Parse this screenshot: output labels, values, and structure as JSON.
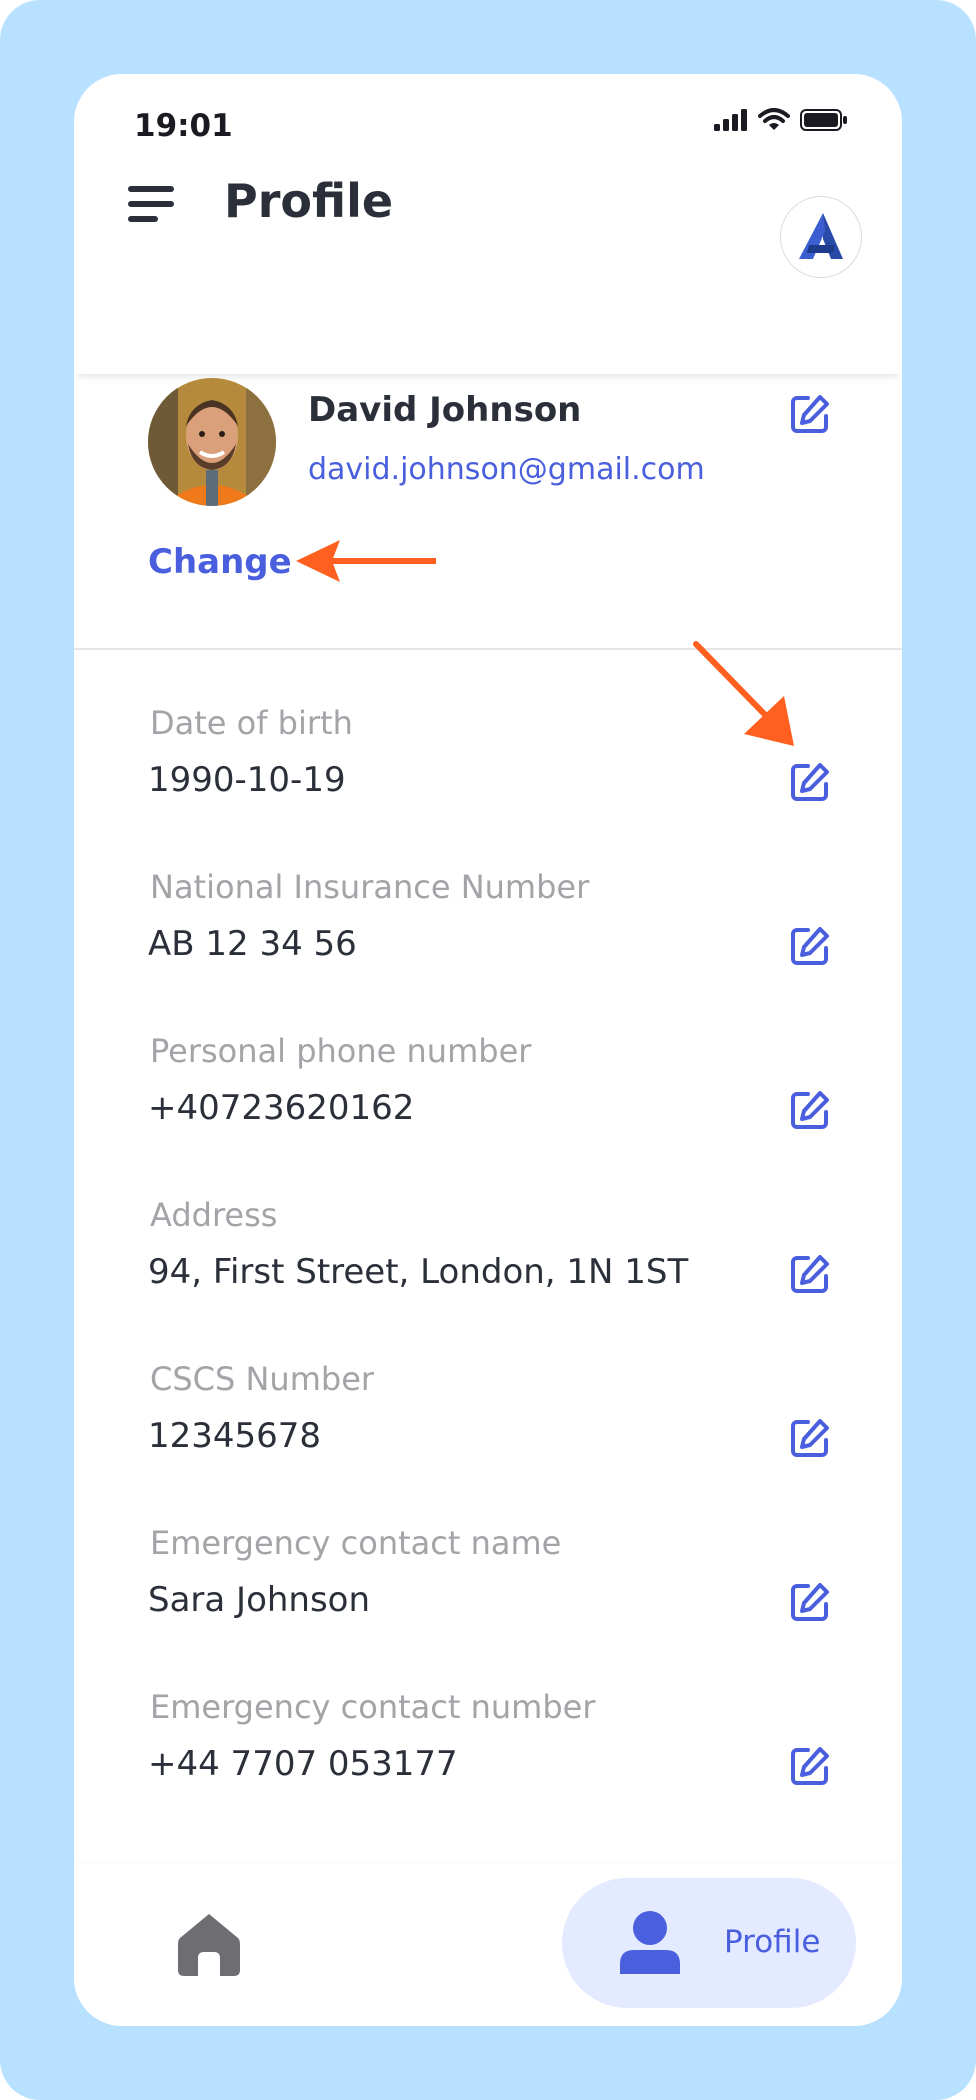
{
  "status_bar": {
    "time": "19:01"
  },
  "header": {
    "title": "Profile"
  },
  "user": {
    "name": "David Johnson",
    "email": "david.johnson@gmail.com",
    "change_label": "Change"
  },
  "fields": [
    {
      "label": "Date of birth",
      "value": "1990-10-19"
    },
    {
      "label": "National Insurance Number",
      "value": "AB 12 34 56"
    },
    {
      "label": "Personal phone number",
      "value": "+40723620162"
    },
    {
      "label": "Address",
      "value": "94, First Street, London, 1N 1ST"
    },
    {
      "label": "CSCS Number",
      "value": "12345678"
    },
    {
      "label": "Emergency contact name",
      "value": "Sara Johnson"
    },
    {
      "label": "Emergency contact number",
      "value": "+44 7707 053177"
    }
  ],
  "bottom_nav": {
    "profile_label": "Profile"
  },
  "colors": {
    "accent": "#4a5fdd",
    "annotation_arrow": "#ff5f1f",
    "frame_background": "#b8e0ff",
    "nav_active_pill": "#e4eaff"
  }
}
